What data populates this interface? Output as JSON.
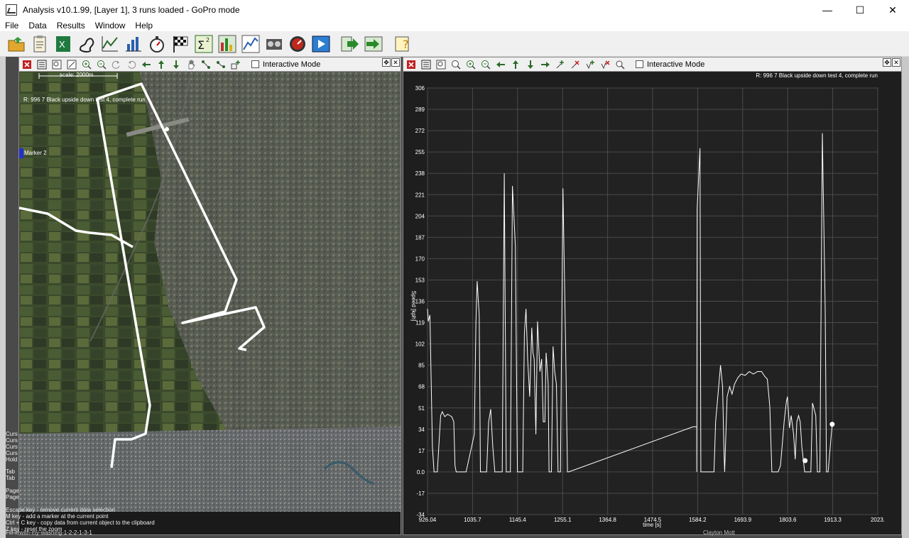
{
  "window": {
    "title": "Analysis v10.1.99, [Layer 1], 3 runs loaded - GoPro mode",
    "minimize": "—",
    "maximize": "☐",
    "close": "✕"
  },
  "menu": [
    {
      "label": "File"
    },
    {
      "label": "Data"
    },
    {
      "label": "Results"
    },
    {
      "label": "Window"
    },
    {
      "label": "Help"
    }
  ],
  "toolbar": {
    "icons": [
      "open-folder-icon",
      "clipboard-icon",
      "excel-export-icon",
      "track-icon",
      "line-chart-icon",
      "bar-chart-icon",
      "stopwatch-icon",
      "checkered-flag-icon",
      "sigma-squared-icon",
      "histogram-icon",
      "xy-plot-icon",
      "video-icon",
      "gauge-icon",
      "play-icon",
      "export-arrow-icon",
      "import-arrow-icon",
      "help-icon"
    ]
  },
  "map_panel": {
    "interactive_label": "Interactive Mode",
    "scale_label": "scale: 2000m",
    "run_label": "R: 996 7 Black upside down test 4, complete run",
    "marker_label": "Marker 2",
    "hints": [
      "Curs",
      "Curs",
      "Curs",
      "Curs",
      "Hold",
      "Tab",
      "Tab",
      "Page",
      "Page",
      "Escape key - remove current data selection",
      "M key - add a marker at the current point",
      "Ctrl + C key - copy data from current object to the clipboard",
      "Z key - reset the zoom"
    ]
  },
  "chart_panel": {
    "interactive_label": "Interactive Mode",
    "run_label": "R: 996 7 Black upside down test 4, complete run"
  },
  "chart_data": {
    "type": "line",
    "xlabel": "time [s]",
    "ylabel": "Speed [kph]",
    "x_ticks": [
      "926.04",
      "1035.7",
      "1145.4",
      "1255.1",
      "1364.8",
      "1474.5",
      "1584.2",
      "1693.9",
      "1803.6",
      "1913.3",
      "2023."
    ],
    "y_ticks": [
      "306",
      "289",
      "272",
      "255",
      "238",
      "221",
      "204",
      "187",
      "170",
      "153",
      "136",
      "119",
      "102",
      "85",
      "68",
      "51",
      "34",
      "17",
      "0.0",
      "-17",
      "-34"
    ],
    "xlim": [
      926.04,
      2023.0
    ],
    "ylim": [
      -34,
      306
    ],
    "grid": true,
    "series": [
      {
        "points": [
          [
            926.04,
            130
          ],
          [
            928,
            120
          ],
          [
            932,
            125
          ],
          [
            938,
            20
          ],
          [
            942,
            0
          ],
          [
            950,
            0
          ],
          [
            958,
            45
          ],
          [
            962,
            48
          ],
          [
            968,
            44
          ],
          [
            975,
            46
          ],
          [
            985,
            44
          ],
          [
            990,
            40
          ],
          [
            993,
            5
          ],
          [
            996,
            0
          ],
          [
            1020,
            0
          ],
          [
            1040,
            30
          ],
          [
            1044,
            120
          ],
          [
            1047,
            152
          ],
          [
            1052,
            125
          ],
          [
            1055,
            0
          ],
          [
            1070,
            0
          ],
          [
            1075,
            40
          ],
          [
            1080,
            50
          ],
          [
            1085,
            20
          ],
          [
            1090,
            0
          ],
          [
            1108,
            0
          ],
          [
            1113,
            238
          ],
          [
            1118,
            0
          ],
          [
            1128,
            0
          ],
          [
            1133,
            228
          ],
          [
            1140,
            180
          ],
          [
            1145,
            0
          ],
          [
            1158,
            0
          ],
          [
            1162,
            110
          ],
          [
            1166,
            130
          ],
          [
            1170,
            90
          ],
          [
            1175,
            60
          ],
          [
            1180,
            115
          ],
          [
            1183,
            95
          ],
          [
            1186,
            90
          ],
          [
            1190,
            30
          ],
          [
            1194,
            120
          ],
          [
            1200,
            80
          ],
          [
            1204,
            90
          ],
          [
            1208,
            40
          ],
          [
            1212,
            40
          ],
          [
            1215,
            95
          ],
          [
            1220,
            70
          ],
          [
            1222,
            0
          ],
          [
            1228,
            0
          ],
          [
            1232,
            100
          ],
          [
            1236,
            80
          ],
          [
            1240,
            70
          ],
          [
            1244,
            0
          ],
          [
            1250,
            0
          ],
          [
            1256,
            226
          ],
          [
            1262,
            110
          ],
          [
            1267,
            0
          ],
          [
            1270,
            0
          ],
          [
            1573,
            36
          ],
          [
            1582,
            36
          ],
          [
            1582,
            0
          ],
          [
            1583,
            210
          ],
          [
            1590,
            258
          ],
          [
            1592,
            0
          ],
          [
            1612,
            0
          ],
          [
            1616,
            0
          ],
          [
            1624,
            0
          ],
          [
            1628,
            40
          ],
          [
            1636,
            70
          ],
          [
            1640,
            85
          ],
          [
            1645,
            68
          ],
          [
            1648,
            20
          ],
          [
            1650,
            0
          ],
          [
            1656,
            60
          ],
          [
            1662,
            68
          ],
          [
            1668,
            62
          ],
          [
            1674,
            70
          ],
          [
            1682,
            75
          ],
          [
            1690,
            78
          ],
          [
            1700,
            77
          ],
          [
            1710,
            80
          ],
          [
            1720,
            78
          ],
          [
            1730,
            80
          ],
          [
            1740,
            80
          ],
          [
            1748,
            76
          ],
          [
            1754,
            74
          ],
          [
            1760,
            52
          ],
          [
            1765,
            0
          ],
          [
            1772,
            0
          ],
          [
            1780,
            0
          ],
          [
            1786,
            5
          ],
          [
            1790,
            20
          ],
          [
            1795,
            40
          ],
          [
            1800,
            55
          ],
          [
            1803,
            60
          ],
          [
            1808,
            35
          ],
          [
            1812,
            45
          ],
          [
            1818,
            30
          ],
          [
            1822,
            10
          ],
          [
            1826,
            40
          ],
          [
            1830,
            45
          ],
          [
            1834,
            40
          ],
          [
            1838,
            20
          ],
          [
            1845,
            0
          ],
          [
            1860,
            0
          ],
          [
            1864,
            55
          ],
          [
            1868,
            50
          ],
          [
            1872,
            45
          ],
          [
            1876,
            0
          ],
          [
            1882,
            0
          ],
          [
            1888,
            270
          ],
          [
            1895,
            130
          ],
          [
            1898,
            0
          ],
          [
            1902,
            0
          ],
          [
            1912,
            38
          ]
        ]
      }
    ],
    "markers": [
      [
        1846,
        9
      ],
      [
        1912,
        38
      ]
    ]
  },
  "background_text": {
    "bottom": "Fill-it-with-my-washing-1-2-2-1-3-1",
    "bottom_right": "Clayton Mott"
  }
}
